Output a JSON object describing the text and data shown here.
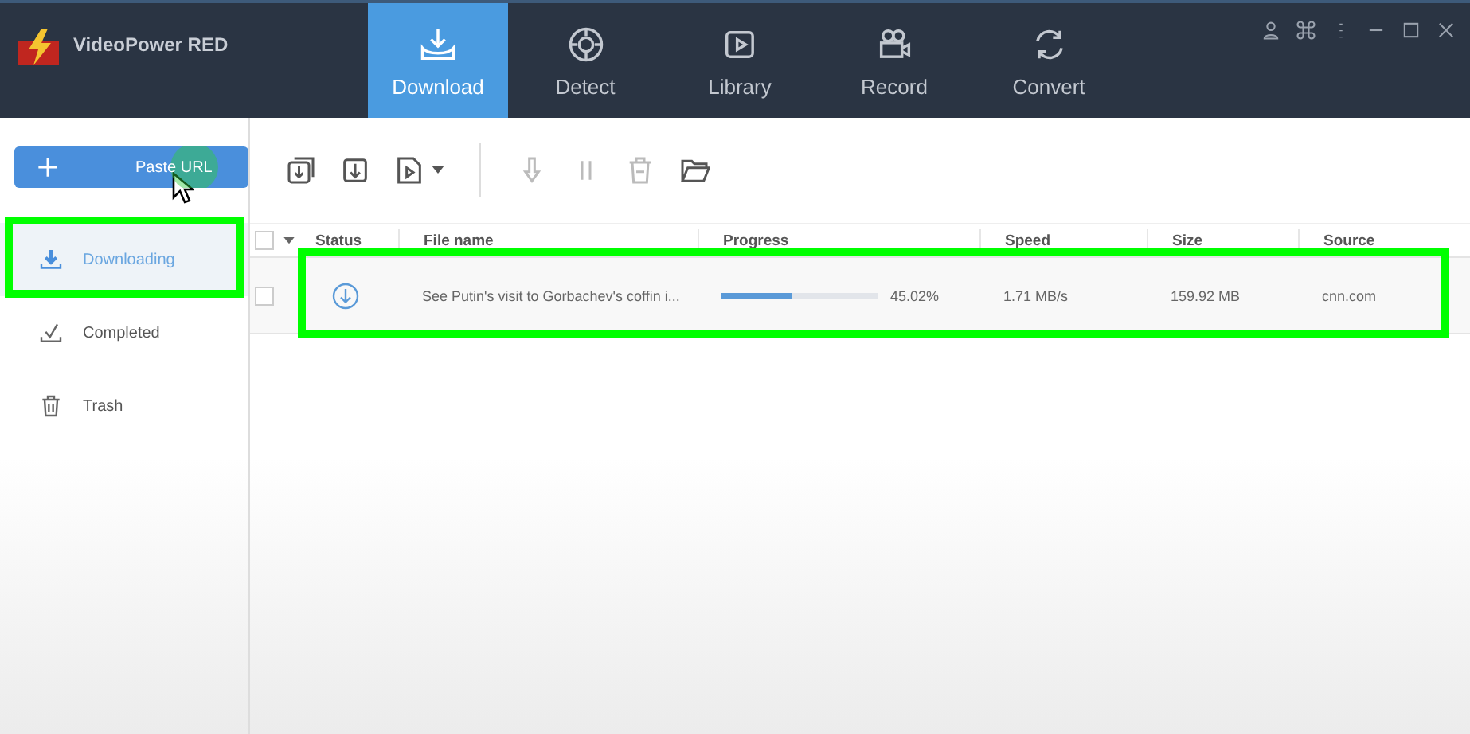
{
  "app": {
    "title": "VideoPower RED"
  },
  "nav_tabs": [
    {
      "label": "Download",
      "selected": true
    },
    {
      "label": "Detect",
      "selected": false
    },
    {
      "label": "Library",
      "selected": false
    },
    {
      "label": "Record",
      "selected": false
    },
    {
      "label": "Convert",
      "selected": false
    }
  ],
  "paste_button": {
    "label": "Paste URL"
  },
  "sidebar": {
    "items": [
      {
        "label": "Downloading",
        "selected": true,
        "highlighted": true
      },
      {
        "label": "Completed",
        "selected": false,
        "highlighted": false
      },
      {
        "label": "Trash",
        "selected": false,
        "highlighted": false
      }
    ]
  },
  "table": {
    "all_checked": false,
    "columns": [
      "Status",
      "File name",
      "Progress",
      "Speed",
      "Size",
      "Source"
    ],
    "rows": [
      {
        "checked": false,
        "highlighted": true,
        "file_name": "See Putin's visit to Gorbachev's coffin i...",
        "level": 0.4502,
        "progress": "45.02%",
        "speed": "1.71 MB/s",
        "size": "159.92 MB",
        "source": "cnn.com"
      }
    ]
  }
}
